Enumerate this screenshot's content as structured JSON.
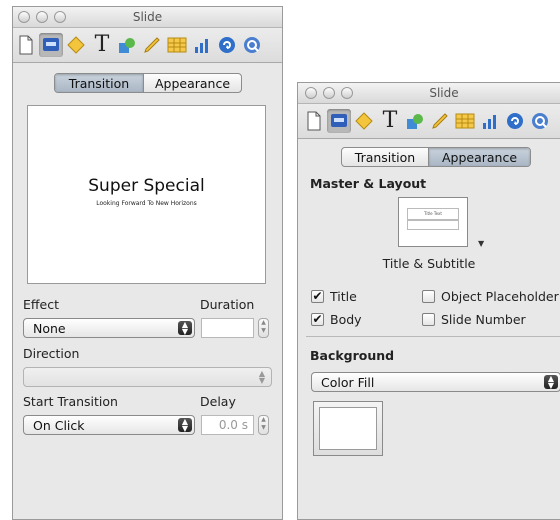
{
  "left_inspector": {
    "title": "Slide",
    "tabs": {
      "transition": "Transition",
      "appearance": "Appearance"
    },
    "preview": {
      "title": "Super Special",
      "subtitle": "Looking Forward To New Horizons"
    },
    "effect_label": "Effect",
    "effect_value": "None",
    "duration_label": "Duration",
    "direction_label": "Direction",
    "start_transition_label": "Start Transition",
    "start_transition_value": "On Click",
    "delay_label": "Delay",
    "delay_value": "0.0 s"
  },
  "right_inspector": {
    "title": "Slide",
    "tabs": {
      "transition": "Transition",
      "appearance": "Appearance"
    },
    "master_layout_header": "Master & Layout",
    "master_thumb_title": "Title Text",
    "master_name": "Title & Subtitle",
    "checkboxes": {
      "title": {
        "label": "Title",
        "checked": true
      },
      "object_placeholder": {
        "label": "Object Placeholder",
        "checked": false
      },
      "body": {
        "label": "Body",
        "checked": true
      },
      "slide_number": {
        "label": "Slide Number",
        "checked": false
      }
    },
    "check_glyph": "✔",
    "background_header": "Background",
    "background_fill": "Color Fill"
  },
  "toolbar_icons": [
    "document-icon",
    "slide-inspector-icon",
    "build-inspector-icon",
    "text-inspector-icon",
    "graphic-inspector-icon",
    "metrics-inspector-icon",
    "table-inspector-icon",
    "chart-inspector-icon",
    "hyperlink-inspector-icon",
    "quicktime-inspector-icon"
  ],
  "colors": {
    "accent_blue": "#2f5fb8",
    "window_bg": "#e8e8e8"
  }
}
